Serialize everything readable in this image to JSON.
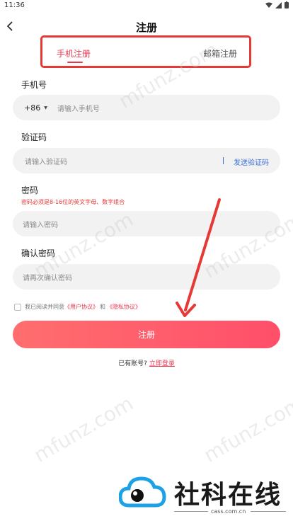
{
  "status": {
    "time": "11:36"
  },
  "header": {
    "title": "注册"
  },
  "tabs": {
    "phone": "手机注册",
    "email": "邮箱注册"
  },
  "phone": {
    "label": "手机号",
    "country_code": "+86",
    "placeholder": "请输入手机号"
  },
  "code": {
    "label": "验证码",
    "placeholder": "请输入验证码",
    "send_label": "发送验证码"
  },
  "password": {
    "label": "密码",
    "hint": "密码必须是8-16位的英文字母、数字组合",
    "placeholder": "请输入密码"
  },
  "confirm": {
    "label": "确认密码",
    "placeholder": "请再次确认密码"
  },
  "agreement": {
    "prefix": "我已阅读并同意",
    "user_agreement": "《用户协议》",
    "and": "和",
    "privacy": "《隐私协议》"
  },
  "submit_label": "注册",
  "login": {
    "prompt": "已有账号?",
    "link": "立即登录"
  },
  "watermark": "mfunz.com",
  "brand": {
    "name": "社科在线",
    "domain": "cass.com.cn"
  },
  "colors": {
    "accent": "#e8364e",
    "highlight_box": "#e53935",
    "link_blue": "#3b6fd8"
  }
}
